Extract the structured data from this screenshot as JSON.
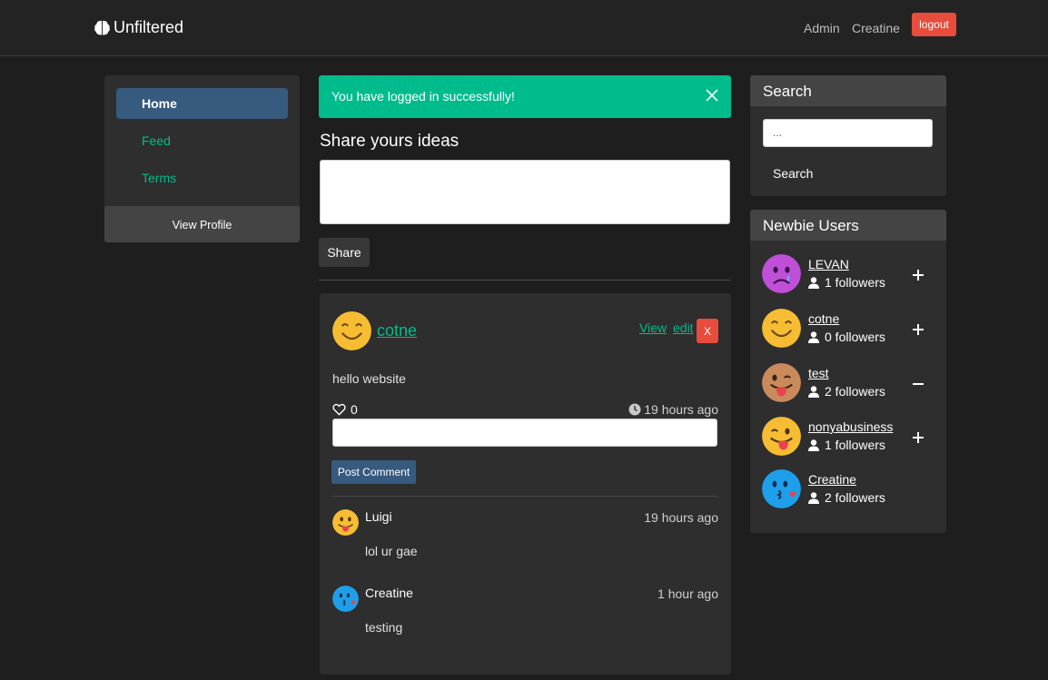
{
  "navbar": {
    "brand": "Unfiltered",
    "links": [
      "Admin",
      "Creatine"
    ],
    "logout_label": "logout"
  },
  "sidebar": {
    "items": [
      {
        "label": "Home",
        "active": true
      },
      {
        "label": "Feed",
        "active": false
      },
      {
        "label": "Terms",
        "active": false
      }
    ],
    "footer_label": "View Profile"
  },
  "main": {
    "alert": "You have logged in successfully!",
    "share_heading": "Share yours ideas",
    "share_button": "Share"
  },
  "post": {
    "author": "cotne",
    "view_label": "View",
    "edit_label": "edit",
    "delete_label": "X",
    "body": "hello website",
    "likes": "0",
    "time": "19 hours ago",
    "comment_button": "Post Comment",
    "comments": [
      {
        "author": "Luigi",
        "time": "19 hours ago",
        "text": "lol ur gae",
        "avatar": "tongue-emoji"
      },
      {
        "author": "Creatine",
        "time": "1 hour ago",
        "text": "testing",
        "avatar": "kiss-emoji"
      }
    ]
  },
  "search": {
    "heading": "Search",
    "placeholder": "...",
    "button": "Search"
  },
  "newbies": {
    "heading": "Newbie Users",
    "users": [
      {
        "name": "LEVAN",
        "followers": "1 followers",
        "action": "follow",
        "avatar": "sad-purple-emoji"
      },
      {
        "name": "cotne",
        "followers": "0 followers",
        "action": "follow",
        "avatar": "smile-emoji"
      },
      {
        "name": "test",
        "followers": "2 followers",
        "action": "unfollow",
        "avatar": "wink-tongue-emoji"
      },
      {
        "name": "nonyabusiness",
        "followers": "1 followers",
        "action": "follow",
        "avatar": "wink-tongue-yellow-emoji"
      },
      {
        "name": "Creatine",
        "followers": "2 followers",
        "action": "none",
        "avatar": "kiss-emoji"
      }
    ]
  },
  "colors": {
    "accent_green": "#00bc8c",
    "primary_blue": "#375a7f",
    "danger_red": "#e74c3c",
    "background": "#1e1e1e",
    "card": "#2e2e2e"
  }
}
